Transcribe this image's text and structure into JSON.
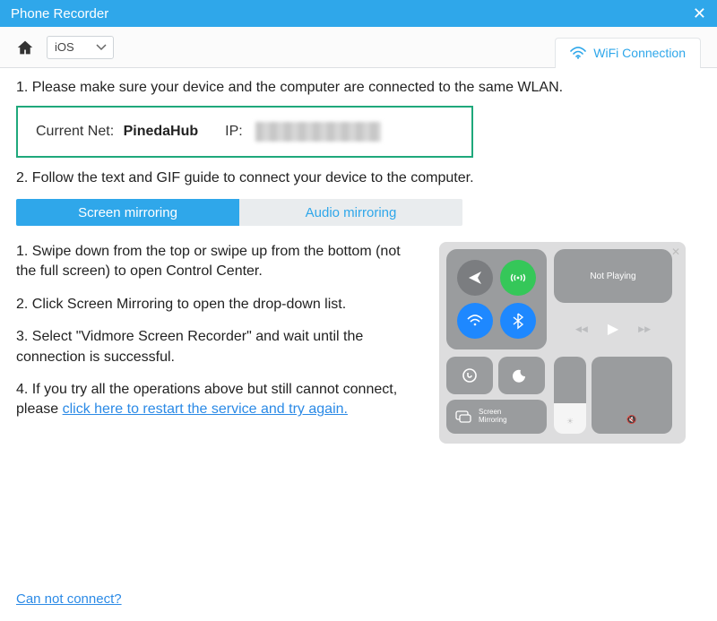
{
  "title": "Phone Recorder",
  "toolbar": {
    "platform": "iOS",
    "wifi_label": "WiFi Connection"
  },
  "steps": {
    "s1": "1. Please make sure your device and the computer are connected to the same WLAN.",
    "s2": "2. Follow the text and GIF guide to connect your device to the computer.",
    "net_label": "Current Net:",
    "net_value": "PinedaHub",
    "ip_label": "IP:"
  },
  "tabs": {
    "screen": "Screen mirroring",
    "audio": "Audio mirroring"
  },
  "guide": {
    "g1": "1. Swipe down from the top or swipe up from the bottom (not the full screen) to open Control Center.",
    "g2": "2. Click Screen Mirroring to open the drop-down list.",
    "g3": "3. Select \"Vidmore Screen Recorder\" and wait until the connection is successful.",
    "g4a": "4. If you try all the operations above but still cannot connect, please ",
    "g4b": "click here to restart the service and try again."
  },
  "cc": {
    "not_playing": "Not Playing",
    "screen_mirroring": "Screen\nMirroring"
  },
  "footer": {
    "cannot": "Can not connect?"
  }
}
